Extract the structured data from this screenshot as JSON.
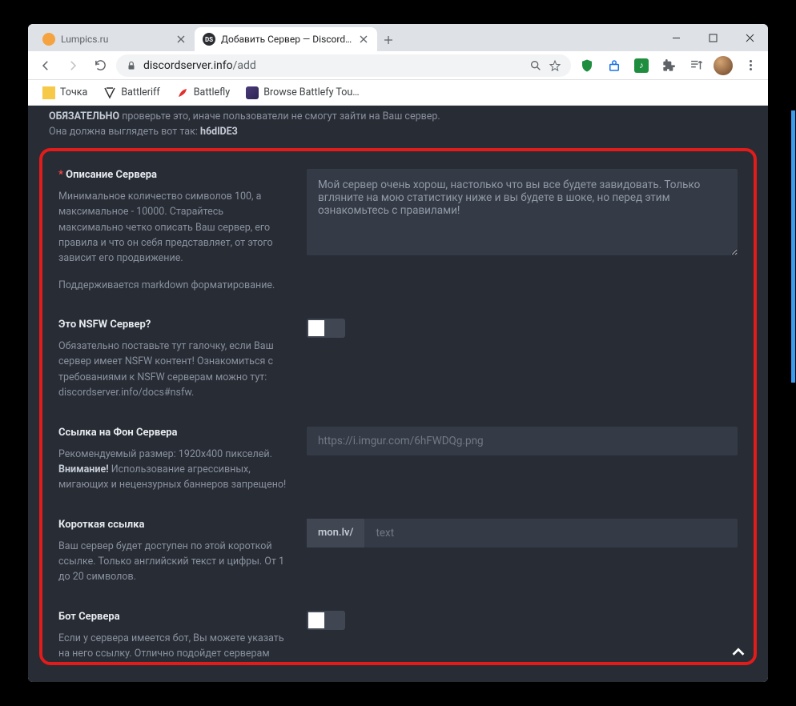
{
  "window": {
    "minimize": "—",
    "maximize": "□",
    "close": "×"
  },
  "tabs": [
    {
      "title": "Lumpics.ru",
      "favicon_color": "#f4a340",
      "active": false
    },
    {
      "title": "Добавить Сервер — DiscordSer",
      "favicon_bg": "#2b2d32",
      "favicon_text": "DS",
      "active": true
    }
  ],
  "address": {
    "host": "discordserver.info",
    "path": "/add"
  },
  "bookmarks": [
    {
      "label": "Точка",
      "icon_color": "#f7c948"
    },
    {
      "label": "Battleriff",
      "icon_bw": true
    },
    {
      "label": "Battlefly",
      "icon_color": "#e03131"
    },
    {
      "label": "Browse Battlefy Tou…",
      "icon_img": true
    }
  ],
  "top_notice": {
    "bold_lead": "ОБЯЗАТЕЛЬНО",
    "line1": " проверьте это, иначе пользователи не смогут зайти на Ваш сервер.",
    "line2": "Она должна выглядеть вот так: ",
    "code": "h6dlDE3"
  },
  "sections": {
    "desc": {
      "required": "*",
      "label": "Описание Сервера",
      "help": "Минимальное количество символов 100, а максимальное - 10000. Старайтесь максимально четко описать Ваш сервер, его правила и что он себя представляет, от этого зависит его продвижение.",
      "help2": "Поддерживается markdown форматирование.",
      "value": "Мой сервер очень хорош, настолько что вы все будете завидовать. Только вгляните на мою статистику ниже и вы будете в шоке, но перед этим ознакомьтесь с правилами!"
    },
    "nsfw": {
      "label": "Это NSFW Сервер?",
      "help": "Обязательно поставьте тут галочку, если Ваш сервер имеет NSFW контент! Ознакомиться с требованиями к NSFW серверам можно тут: discordserver.info/docs#nsfw."
    },
    "bg": {
      "label": "Ссылка на Фон Сервера",
      "help_pre": "Рекомендуемый размер: 1920x400 пикселей. ",
      "help_bold": "Внимание!",
      "help_post": " Использование агрессивных, мигающих и нецензурных баннеров запрещено!",
      "placeholder": "https://i.imgur.com/6hFWDQg.png"
    },
    "shortlink": {
      "label": "Короткая ссылка",
      "help": "Ваш сервер будет доступен по этой короткой ссылке. Только английский текст и цифры. От 1 до 20 символов.",
      "prefix": "mon.lv/",
      "placeholder": "text"
    },
    "bot": {
      "label": "Бот Сервера",
      "help": "Если у сервера имеется бот, Вы можете указать на него ссылку. Отлично подойдет серверам"
    }
  }
}
